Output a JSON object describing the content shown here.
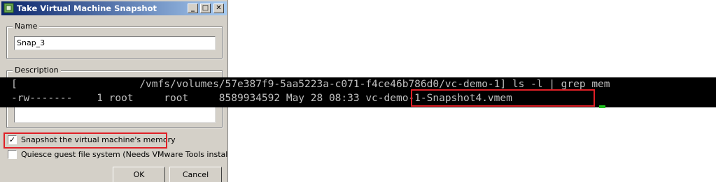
{
  "dialog": {
    "title": "Take Virtual Machine Snapshot",
    "buttons": {
      "minimize": "_",
      "maximize": "□",
      "close": "✕"
    },
    "name_group": {
      "label": "Name",
      "value": "Snap_3"
    },
    "description_group": {
      "label": "Description",
      "value": ""
    },
    "options": [
      {
        "label": "Snapshot the virtual machine's memory",
        "checked": true
      },
      {
        "label": "Quiesce guest file system (Needs VMware Tools installed)",
        "checked": false
      }
    ],
    "ok_label": "OK",
    "cancel_label": "Cancel",
    "icons": [
      "vm-icon"
    ]
  },
  "terminal": {
    "line1": "[                    /vmfs/volumes/57e387f9-5aa5223a-c071-f4ce46b786d0/vc-demo-1] ls -l | grep mem",
    "line2_prefix": "-rw-------    1 root     root     8589934592 May 28 08:33 ",
    "line2_file": "vc-demo-1-Snapshot4.vmem",
    "colors": {
      "text": "#c0c0c0",
      "background": "#000000",
      "cursor": "#1fc01f"
    }
  },
  "highlight_color": "#e01f26"
}
